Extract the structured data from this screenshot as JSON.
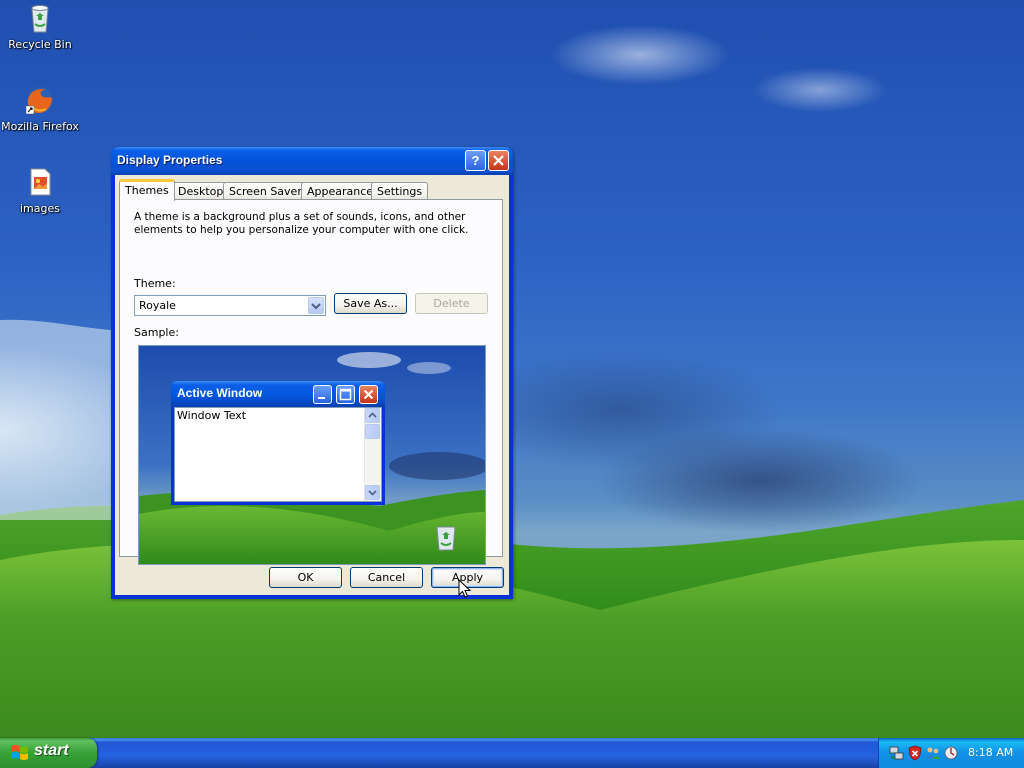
{
  "desktop": {
    "icons": [
      {
        "label": "Recycle Bin",
        "icon": "recycle-bin-icon"
      },
      {
        "label": "Mozilla Firefox",
        "icon": "firefox-icon"
      },
      {
        "label": "images",
        "icon": "image-file-icon"
      }
    ]
  },
  "dialog": {
    "title": "Display Properties",
    "help_button": "?",
    "tabs": [
      "Themes",
      "Desktop",
      "Screen Saver",
      "Appearance",
      "Settings"
    ],
    "active_tab": "Themes",
    "description": "A theme is a background plus a set of sounds, icons, and other elements to help you personalize your computer with one click.",
    "theme_label": "Theme:",
    "theme_value": "Royale",
    "save_as_label": "Save As...",
    "delete_label": "Delete",
    "sample_label": "Sample:",
    "sample": {
      "window_title": "Active Window",
      "window_text": "Window Text"
    },
    "ok_label": "OK",
    "cancel_label": "Cancel",
    "apply_label": "Apply"
  },
  "taskbar": {
    "start_label": "start",
    "clock": "8:18 AM",
    "tray_icons": [
      "network-icon",
      "security-shield-icon",
      "users-icon",
      "tray-app-icon"
    ]
  },
  "colors": {
    "titlebar": "#0354dc",
    "start_button": "#37a137",
    "taskbar": "#2663e0",
    "dialog_face": "#ece9d8",
    "tab_highlight": "#ffc83c"
  }
}
